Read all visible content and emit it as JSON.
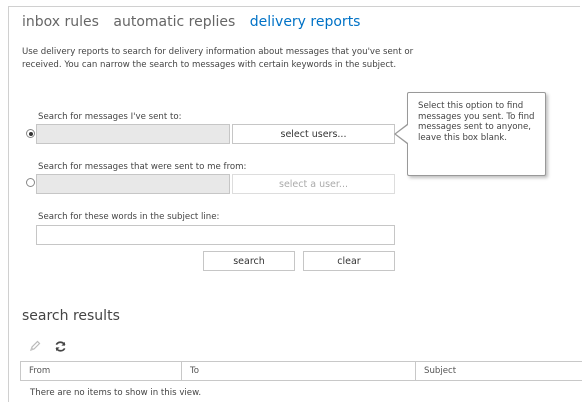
{
  "tabs": [
    {
      "label": "inbox rules",
      "active": false
    },
    {
      "label": "automatic replies",
      "active": false
    },
    {
      "label": "delivery reports",
      "active": true
    }
  ],
  "description": "Use delivery reports to search for delivery information about messages that you've sent or received. You can narrow the search to messages with certain keywords in the subject.",
  "search_sent_to": {
    "label": "Search for messages I've sent to:",
    "selected": true,
    "value": "",
    "button_label": "select users..."
  },
  "search_sent_from": {
    "label": "Search for messages that were sent to me from:",
    "selected": false,
    "value": "",
    "button_label": "select a user..."
  },
  "subject_search": {
    "label": "Search for these words in the subject line:",
    "value": ""
  },
  "actions": {
    "search_label": "search",
    "clear_label": "clear"
  },
  "tooltip": "Select this option to find messages you sent. To find messages sent to anyone, leave this box blank.",
  "results": {
    "title": "search results",
    "columns": [
      "From",
      "To",
      "Subject"
    ],
    "empty_message": "There are no items to show in this view."
  },
  "icons": {
    "edit": "pencil-icon",
    "refresh": "refresh-icon"
  },
  "colors": {
    "accent": "#0072c6",
    "disabled_field": "#e8e8e8"
  }
}
